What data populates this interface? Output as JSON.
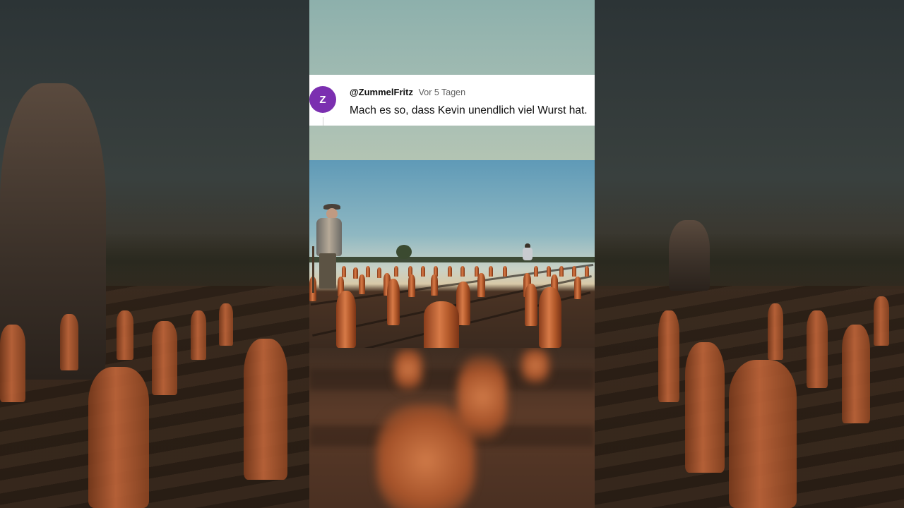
{
  "comment": {
    "avatar_letter": "Z",
    "avatar_color": "#7b2fb0",
    "username": "@ZummelFritz",
    "timestamp": "Vor 5 Tagen",
    "text": "Mach es so, dass Kevin unendlich viel Wurst hat."
  },
  "scene": {
    "description_icons": [
      "farmer",
      "sausage-field",
      "sky"
    ]
  }
}
